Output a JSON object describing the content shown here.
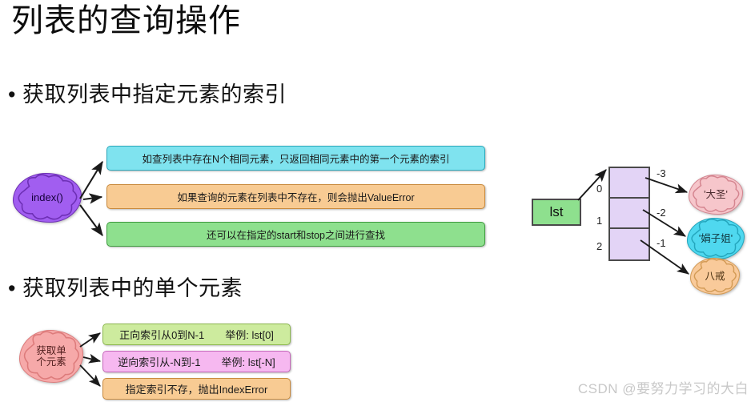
{
  "slide": {
    "title": "列表的查询操作",
    "bullets": [
      {
        "marker": "•",
        "text": "获取列表中指定元素的索引"
      },
      {
        "marker": "•",
        "text": "获取列表中的单个元素"
      }
    ],
    "watermark": "CSDN @要努力学习的大白"
  },
  "index_diagram": {
    "source_label": "index()",
    "boxes": [
      {
        "text": "如查列表中存在N个相同元素，只返回相同元素中的第一个元素的索引",
        "color": "#7fe3ef",
        "border": "#2aa8bb"
      },
      {
        "text": "如果查询的元素在列表中不存在，则会抛出ValueError",
        "color": "#f8cb93",
        "border": "#c98a3d"
      },
      {
        "text": "还可以在指定的start和stop之间进行查找",
        "color": "#8ee08e",
        "border": "#3f9c3f"
      }
    ]
  },
  "list_diagram": {
    "variable_label": "lst",
    "forward_indexes": [
      "0",
      "1",
      "2"
    ],
    "negative_indexes": [
      "-3",
      "-2",
      "-1"
    ],
    "elements": [
      {
        "label": "'大圣'",
        "color": "#f6c6cb"
      },
      {
        "label": "'娟子姐'",
        "color": "#4fd8ef"
      },
      {
        "label": "八戒",
        "color": "#f9ca9a"
      }
    ]
  },
  "single_element_diagram": {
    "source_label_line1": "获取单",
    "source_label_line2": "个元素",
    "boxes": [
      {
        "text": "正向索引从0到N-1　　举例: lst[0]",
        "color": "#cdeb9e",
        "border": "#8db84f"
      },
      {
        "text": "逆向索引从-N到-1　　举例: lst[-N]",
        "color": "#f6b8f0",
        "border": "#c568bb"
      },
      {
        "text": "指定索引不存，抛出IndexError",
        "color": "#f8cb93",
        "border": "#c98a3d"
      }
    ]
  }
}
